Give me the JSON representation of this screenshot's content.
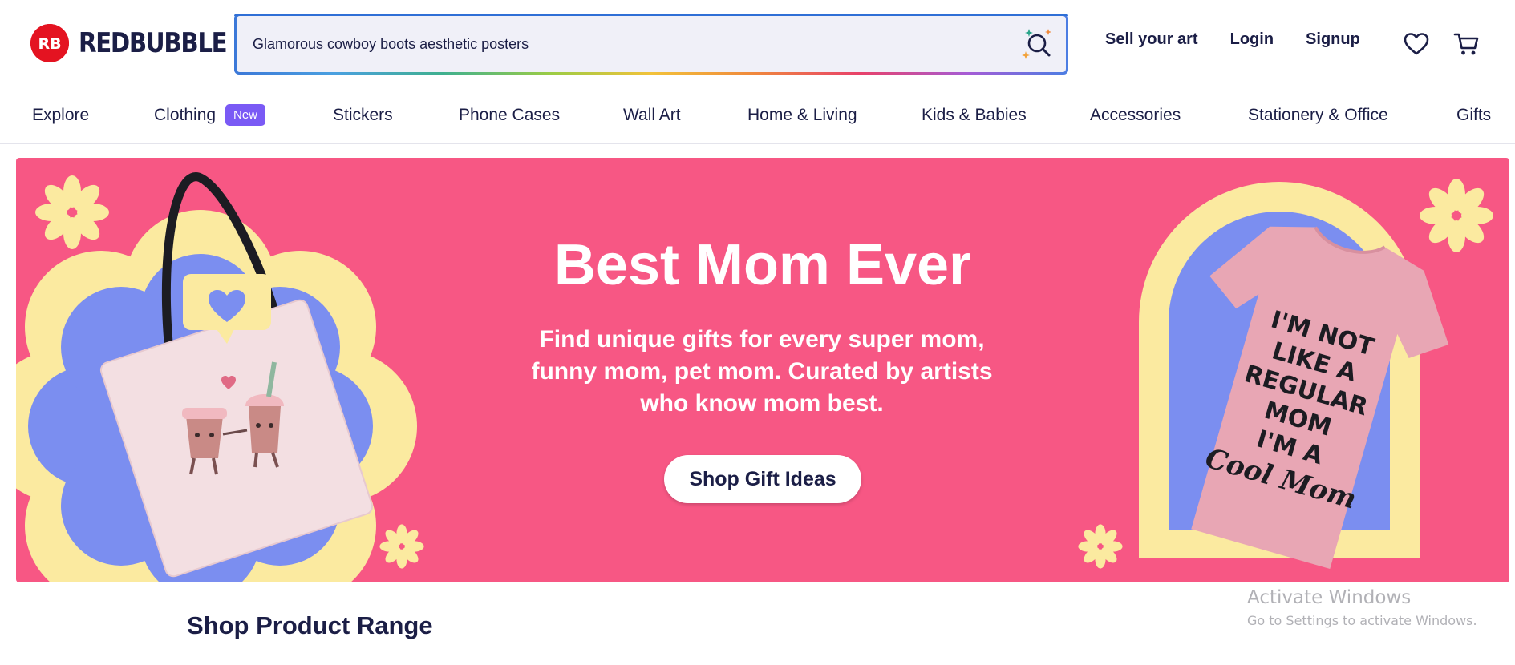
{
  "brand": {
    "name": "REDBUBBLE",
    "color": "#e41321",
    "mark": "RB"
  },
  "search": {
    "value": "Glamorous cowboy boots aesthetic posters",
    "placeholder": "Search designs and products",
    "icon": "search-sparkle-icon"
  },
  "top_links": {
    "sell": "Sell your art",
    "login": "Login",
    "signup": "Signup"
  },
  "icons": {
    "wishlist": "heart-icon",
    "cart": "cart-icon"
  },
  "nav": {
    "items": [
      "Explore",
      "Clothing",
      "Stickers",
      "Phone Cases",
      "Wall Art",
      "Home & Living",
      "Kids & Babies",
      "Accessories",
      "Stationery & Office",
      "Gifts"
    ],
    "badge": "New"
  },
  "hero": {
    "title": "Best Mom Ever",
    "text": "Find unique gifts for every super mom, funny mom, pet mom. Curated by artists who know mom best.",
    "cta": "Shop Gift Ideas",
    "background": "#f75784",
    "shirt_text": [
      "I'M NOT",
      "LIKE A",
      "REGULAR",
      "MOM",
      "I'M A",
      "Cool Mom"
    ]
  },
  "section": {
    "title": "Shop Product Range"
  },
  "watermark": {
    "title": "Activate Windows",
    "subtitle": "Go to Settings to activate Windows."
  }
}
